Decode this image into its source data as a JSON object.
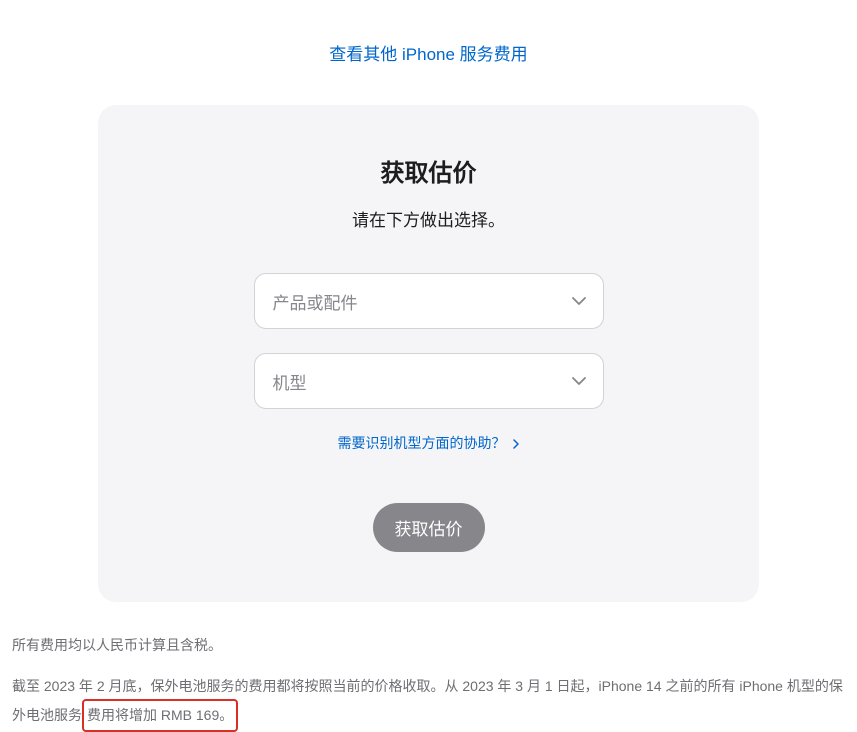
{
  "topLink": "查看其他 iPhone 服务费用",
  "card": {
    "title": "获取估价",
    "subtitle": "请在下方做出选择。",
    "select1Placeholder": "产品或配件",
    "select2Placeholder": "机型",
    "helpLink": "需要识别机型方面的协助？",
    "submitLabel": "获取估价"
  },
  "footer": {
    "line1": "所有费用均以人民币计算且含税。",
    "line2_part1": "截至 2023 年 2 月底，保外电池服务的费用都将按照当前的价格收取。从 2023 年 3 月 1 日起，iPhone 14 之前的所有 iPhone 机型的保外电池服务",
    "line2_highlight": "费用将增加 RMB 169。"
  }
}
